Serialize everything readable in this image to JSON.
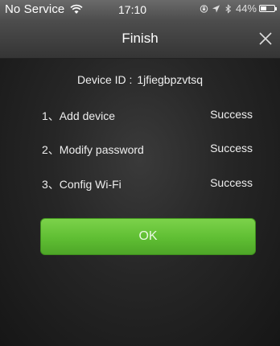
{
  "status_bar": {
    "carrier": "No Service",
    "time": "17:10",
    "battery_percent_text": "44%",
    "battery_level": 0.44,
    "icons": [
      "wifi-icon",
      "lock-rotation-icon",
      "location-icon",
      "bluetooth-icon",
      "battery-icon"
    ]
  },
  "nav": {
    "title": "Finish",
    "close_icon": "close-icon"
  },
  "device": {
    "label": "Device ID :",
    "value": "1jfiegbpzvtsq"
  },
  "steps": [
    {
      "label": "1、Add device",
      "status": "Success"
    },
    {
      "label": "2、Modify password",
      "status": "Success"
    },
    {
      "label": "3、Config Wi-Fi",
      "status": "Success"
    }
  ],
  "ok_button": {
    "label": "OK"
  },
  "colors": {
    "button_green": "#5fbe33",
    "background": "#262626",
    "text": "#eeeeee"
  }
}
